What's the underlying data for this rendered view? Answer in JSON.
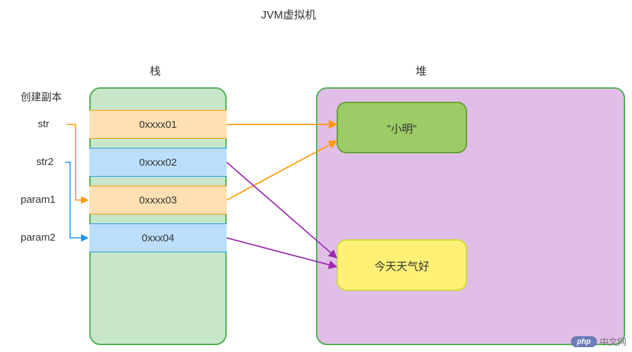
{
  "title": "JVM虚拟机",
  "stack": {
    "title": "栈",
    "copy_label": "创建副本",
    "slots": [
      {
        "label": "str",
        "value": "0xxxx01",
        "color": "orange"
      },
      {
        "label": "str2",
        "value": "0xxxx02",
        "color": "blue"
      },
      {
        "label": "param1",
        "value": "0xxxx03",
        "color": "orange"
      },
      {
        "label": "param2",
        "value": "0xxx04",
        "color": "blue"
      }
    ]
  },
  "heap": {
    "title": "堆",
    "nodes": [
      {
        "id": "node_xiaoming",
        "text": "\"小明\"",
        "color": "green"
      },
      {
        "id": "node_weather",
        "text": "今天天气好",
        "color": "yellow"
      }
    ]
  },
  "arrows": [
    {
      "from": "slot_str",
      "to": "node_xiaoming",
      "color": "#ff9800"
    },
    {
      "from": "slot_str2",
      "to": "node_weather",
      "color": "#9c27b0"
    },
    {
      "from": "slot_param1",
      "to": "node_xiaoming",
      "color": "#ff9800"
    },
    {
      "from": "slot_param2",
      "to": "node_weather",
      "color": "#9c27b0"
    },
    {
      "from": "label_str",
      "to": "slot_param1",
      "color": "#ff9800",
      "type": "copy"
    },
    {
      "from": "label_str2",
      "to": "slot_param2",
      "color": "#2196f3",
      "type": "copy"
    }
  ],
  "watermark": {
    "badge": "php",
    "text": "中文网"
  }
}
